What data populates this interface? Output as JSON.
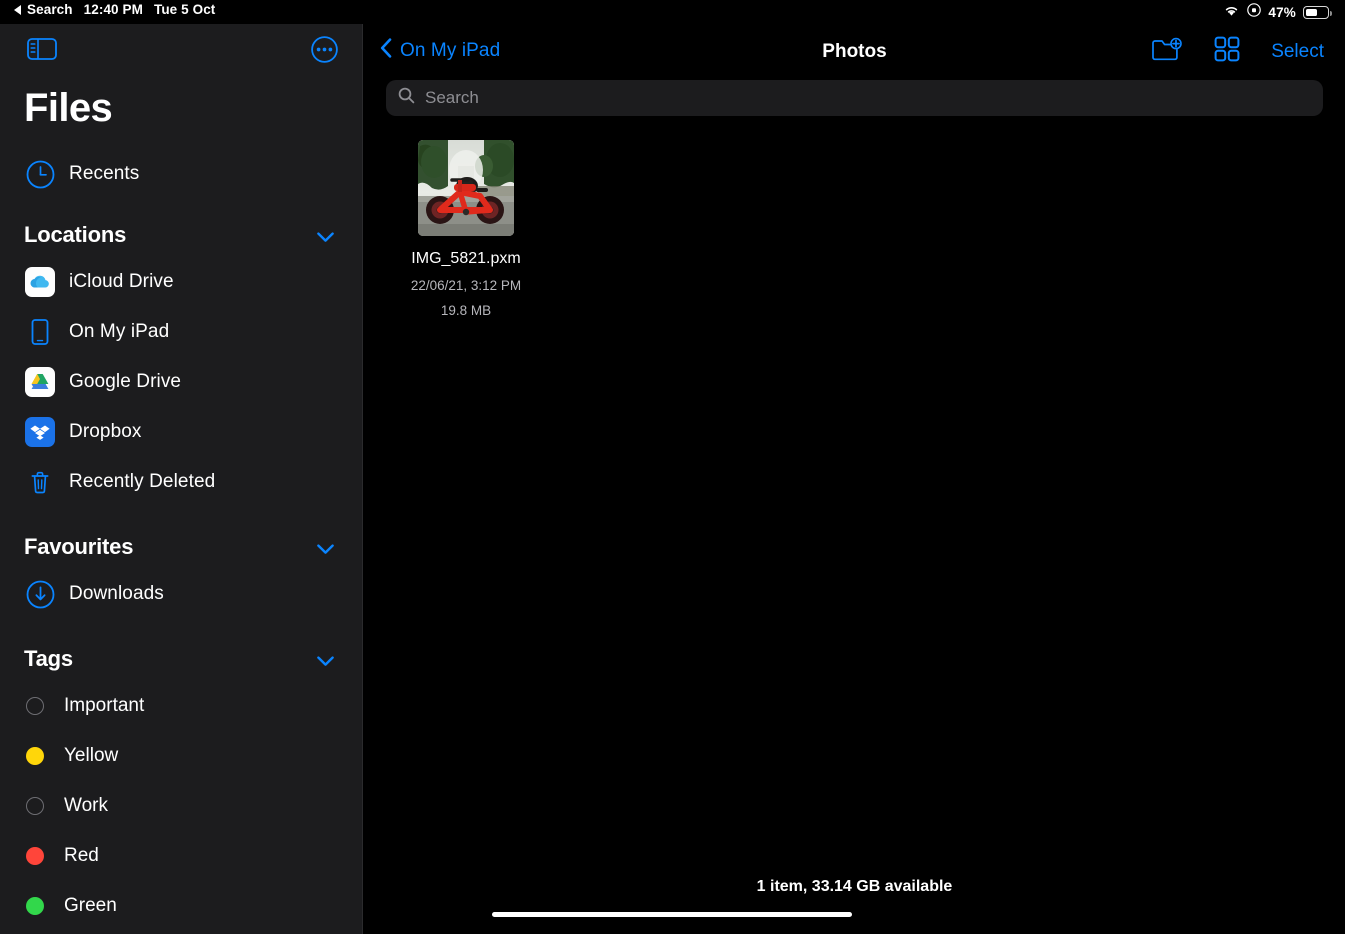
{
  "status_bar": {
    "back_label": "Search",
    "time": "12:40 PM",
    "date": "Tue 5 Oct",
    "wifi_icon": "wifi-icon",
    "lock_rotation_icon": "screen-rotation-lock-icon",
    "battery_percent": "47%",
    "battery_icon": "battery-icon"
  },
  "sidebar": {
    "toggle_icon": "sidebar-toggle-icon",
    "more_icon": "more-options-icon",
    "title": "Files",
    "recents": {
      "label": "Recents",
      "icon": "clock-icon"
    },
    "sections": [
      {
        "title": "Locations",
        "chevron_icon": "chevron-down-icon",
        "items": [
          {
            "label": "iCloud Drive",
            "icon": "icloud-drive-icon"
          },
          {
            "label": "On My iPad",
            "icon": "ipad-icon"
          },
          {
            "label": "Google Drive",
            "icon": "google-drive-icon"
          },
          {
            "label": "Dropbox",
            "icon": "dropbox-icon"
          },
          {
            "label": "Recently Deleted",
            "icon": "trash-icon"
          }
        ]
      },
      {
        "title": "Favourites",
        "chevron_icon": "chevron-down-icon",
        "items": [
          {
            "label": "Downloads",
            "icon": "download-circle-icon"
          }
        ]
      },
      {
        "title": "Tags",
        "chevron_icon": "chevron-down-icon",
        "items": [
          {
            "label": "Important",
            "color": "none"
          },
          {
            "label": "Yellow",
            "color": "#ffd60a"
          },
          {
            "label": "Work",
            "color": "none"
          },
          {
            "label": "Red",
            "color": "#ff453a"
          },
          {
            "label": "Green",
            "color": "#32d74b"
          }
        ]
      }
    ]
  },
  "main": {
    "back_label": "On My iPad",
    "back_icon": "chevron-left-icon",
    "title": "Photos",
    "new_folder_icon": "new-folder-icon",
    "grid_view_icon": "grid-view-icon",
    "select_label": "Select",
    "search": {
      "placeholder": "Search",
      "icon": "search-icon",
      "value": ""
    },
    "files": [
      {
        "name": "IMG_5821.pxm",
        "date": "22/06/21, 3:12 PM",
        "size": "19.8 MB",
        "thumbnail": "red-fat-tire-bicycle-on-street"
      }
    ],
    "status": "1 item, 33.14 GB available"
  },
  "colors": {
    "accent": "#0a84ff",
    "sidebar_bg": "#1c1c1e",
    "main_bg": "#000000"
  }
}
